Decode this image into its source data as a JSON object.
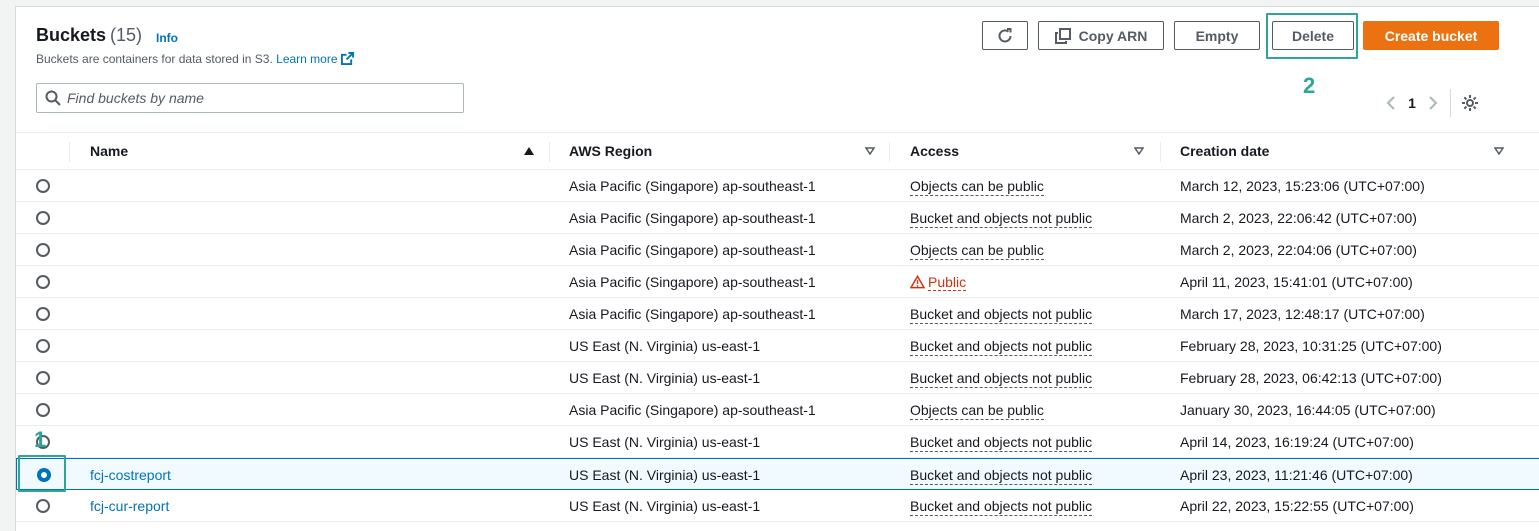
{
  "header": {
    "title": "Buckets",
    "count": "(15)",
    "info_label": "Info",
    "description": "Buckets are containers for data stored in S3.",
    "learn_more": "Learn more"
  },
  "toolbar": {
    "copy_arn_label": "Copy ARN",
    "empty_label": "Empty",
    "delete_label": "Delete",
    "create_label": "Create bucket"
  },
  "search": {
    "placeholder": "Find buckets by name"
  },
  "pagination": {
    "current_page": "1"
  },
  "annotations": {
    "step_1": "1",
    "step_2": "2"
  },
  "columns": {
    "name": "Name",
    "region": "AWS Region",
    "access": "Access",
    "created": "Creation date"
  },
  "rows": [
    {
      "name": "",
      "region": "Asia Pacific (Singapore) ap-southeast-1",
      "access": "Objects can be public",
      "created": "March 12, 2023, 15:23:06 (UTC+07:00)"
    },
    {
      "name": "",
      "region": "Asia Pacific (Singapore) ap-southeast-1",
      "access": "Bucket and objects not public",
      "created": "March 2, 2023, 22:06:42 (UTC+07:00)"
    },
    {
      "name": "",
      "region": "Asia Pacific (Singapore) ap-southeast-1",
      "access": "Objects can be public",
      "created": "March 2, 2023, 22:04:06 (UTC+07:00)"
    },
    {
      "name": "",
      "region": "Asia Pacific (Singapore) ap-southeast-1",
      "access": "Public",
      "created": "April 11, 2023, 15:41:01 (UTC+07:00)"
    },
    {
      "name": "",
      "region": "Asia Pacific (Singapore) ap-southeast-1",
      "access": "Bucket and objects not public",
      "created": "March 17, 2023, 12:48:17 (UTC+07:00)"
    },
    {
      "name": "",
      "region": "US East (N. Virginia) us-east-1",
      "access": "Bucket and objects not public",
      "created": "February 28, 2023, 10:31:25 (UTC+07:00)"
    },
    {
      "name": "",
      "region": "US East (N. Virginia) us-east-1",
      "access": "Bucket and objects not public",
      "created": "February 28, 2023, 06:42:13 (UTC+07:00)"
    },
    {
      "name": "",
      "region": "Asia Pacific (Singapore) ap-southeast-1",
      "access": "Objects can be public",
      "created": "January 30, 2023, 16:44:05 (UTC+07:00)"
    },
    {
      "name": "",
      "region": "US East (N. Virginia) us-east-1",
      "access": "Bucket and objects not public",
      "created": "April 14, 2023, 16:19:24 (UTC+07:00)"
    },
    {
      "name": "fcj-costreport",
      "region": "US East (N. Virginia) us-east-1",
      "access": "Bucket and objects not public",
      "created": "April 23, 2023, 11:21:46 (UTC+07:00)"
    },
    {
      "name": "fcj-cur-report",
      "region": "US East (N. Virginia) us-east-1",
      "access": "Bucket and objects not public",
      "created": "April 22, 2023, 15:22:55 (UTC+07:00)"
    }
  ],
  "colors": {
    "accent": "#ec7211",
    "link": "#0073bb",
    "annotation": "#2ea597",
    "public_warning": "#d13212"
  }
}
